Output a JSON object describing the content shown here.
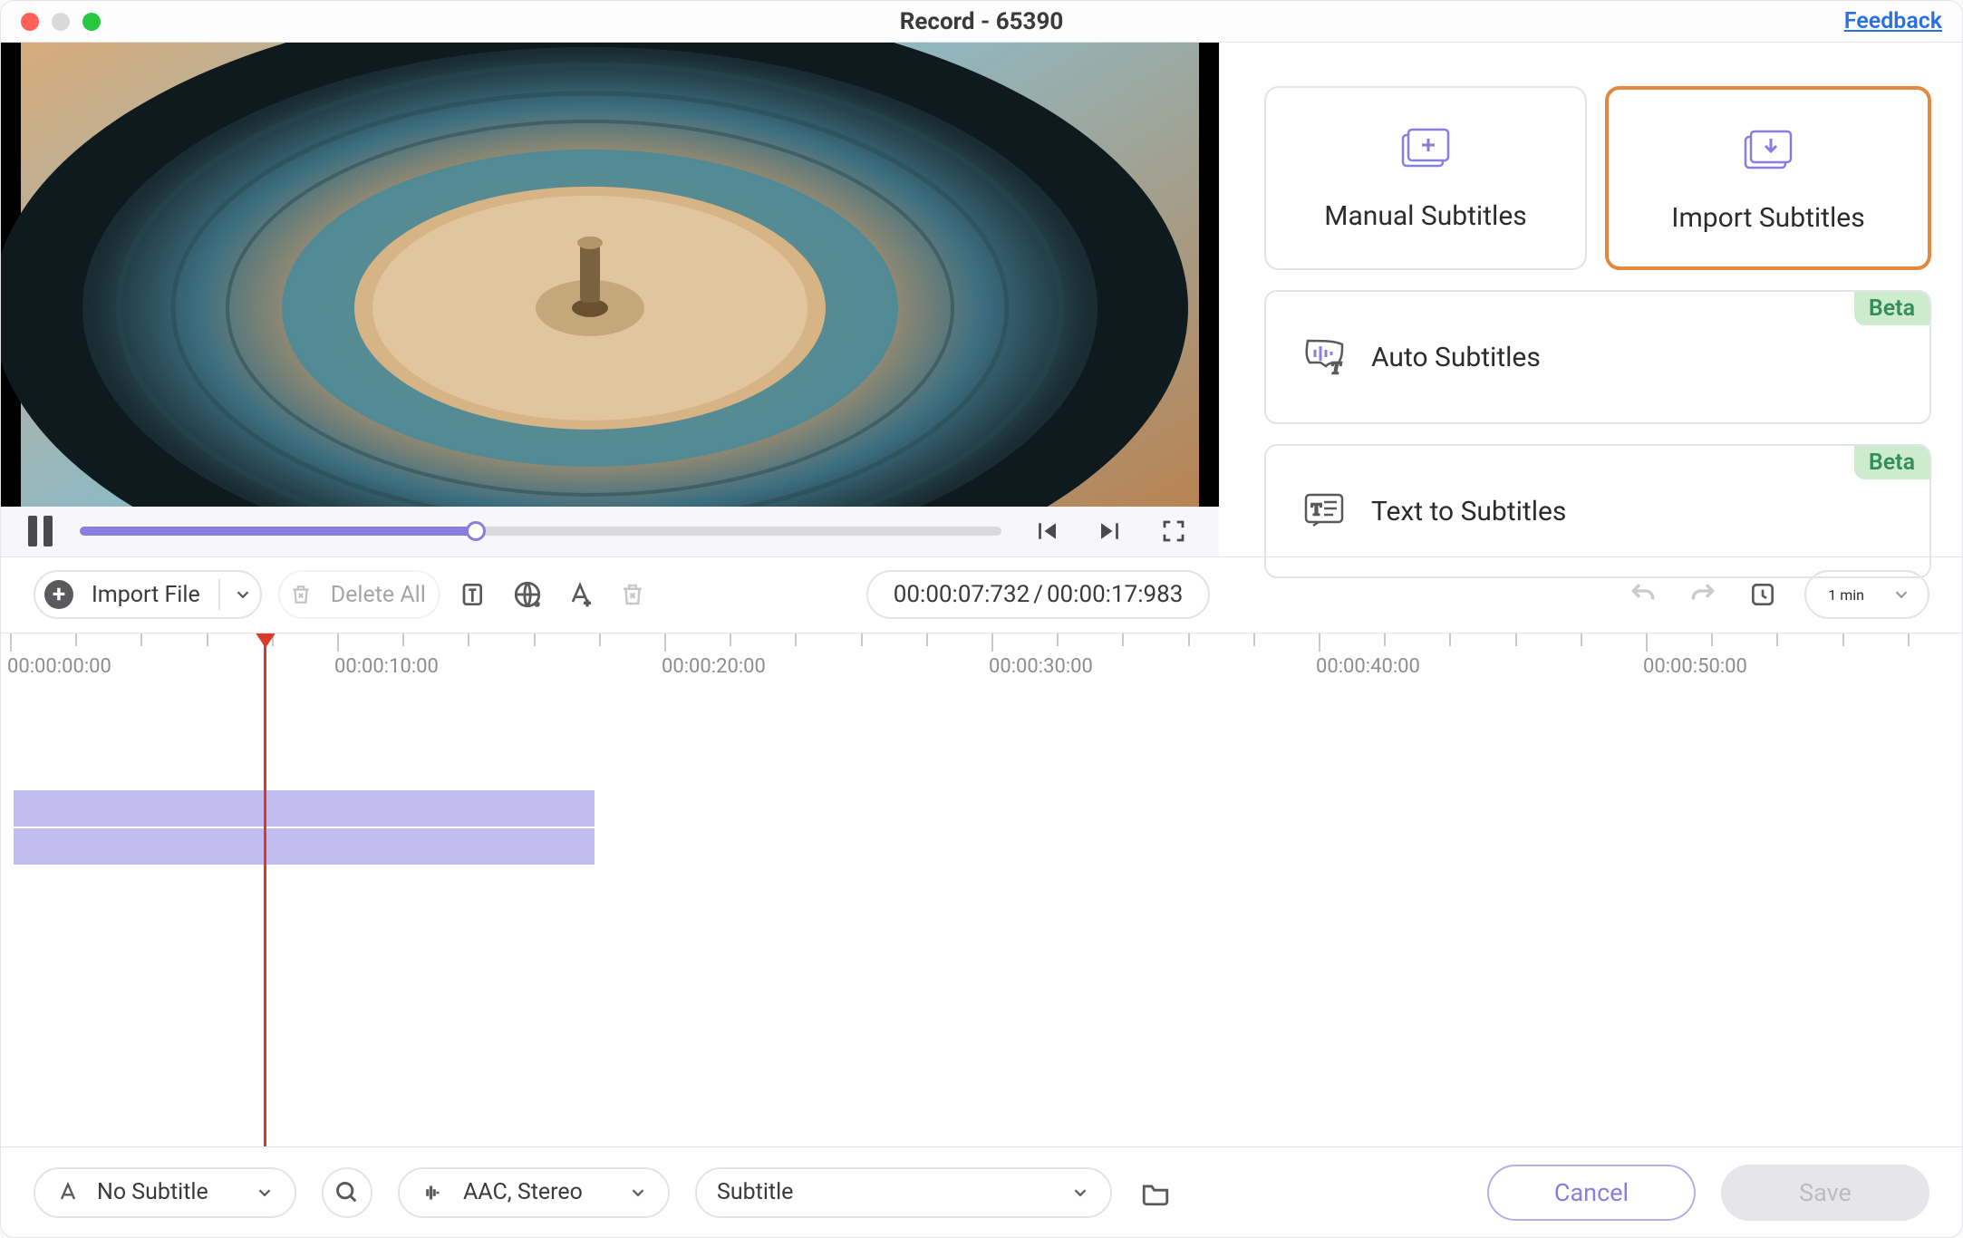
{
  "titlebar": {
    "title": "Record - 65390",
    "feedback": "Feedback"
  },
  "player": {
    "progress_percent": 43
  },
  "subtitle_options": {
    "manual": "Manual Subtitles",
    "import": "Import Subtitles",
    "auto": "Auto Subtitles",
    "text_to": "Text to Subtitles",
    "beta": "Beta"
  },
  "toolbar": {
    "import_file": "Import File",
    "delete_all": "Delete All",
    "time_current": "00:00:07:732",
    "time_total": "00:00:17:983",
    "zoom": "1 min"
  },
  "timeline": {
    "labels": [
      "00:00:00:00",
      "00:00:10:00",
      "00:00:20:00",
      "00:00:30:00",
      "00:00:40:00",
      "00:00:50:00"
    ],
    "clip_start_pct": 0.6,
    "clip_end_pct": 30.3,
    "playhead_pct": 13.4
  },
  "bottom": {
    "subtitle_mode": "No Subtitle",
    "audio": "AAC, Stereo",
    "selector": "Subtitle",
    "cancel": "Cancel",
    "save": "Save"
  },
  "icons": {
    "manual": "manual-subtitle-icon",
    "import": "import-subtitle-icon"
  }
}
